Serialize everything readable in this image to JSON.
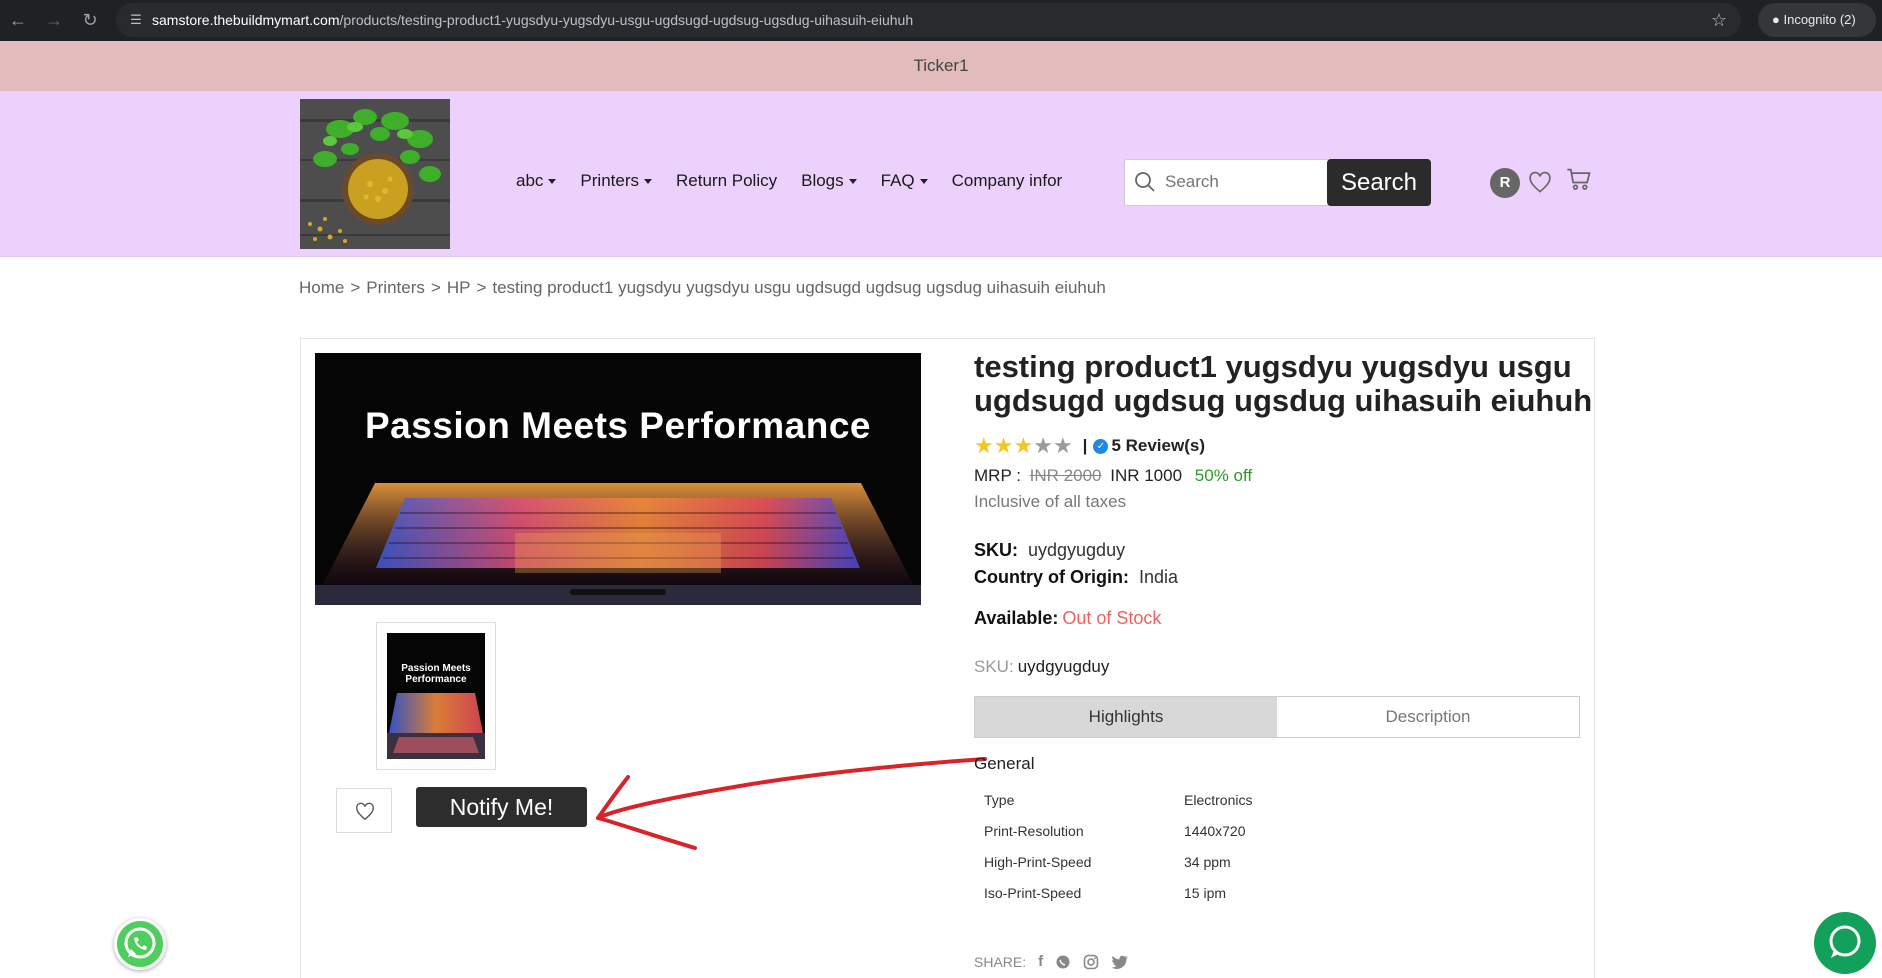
{
  "browser": {
    "url_host": "samstore.thebuildmymart.com",
    "url_path": "/products/testing-product1-yugsdyu-yugsdyu-usgu-ugdsugd-ugdsug-ugsdug-uihasuih-eiuhuh",
    "incognito_label": "Incognito (2)"
  },
  "ticker": {
    "text": "Ticker1"
  },
  "nav": {
    "items": [
      {
        "label": "abc",
        "dropdown": true
      },
      {
        "label": "Printers",
        "dropdown": true
      },
      {
        "label": "Return Policy",
        "dropdown": false
      },
      {
        "label": "Blogs",
        "dropdown": true
      },
      {
        "label": "FAQ",
        "dropdown": true
      },
      {
        "label": "Company infor",
        "dropdown": false
      }
    ]
  },
  "search": {
    "placeholder": "Search",
    "button_label": "Search"
  },
  "user": {
    "avatar_initial": "R"
  },
  "breadcrumb": [
    "Home",
    "Printers",
    "HP",
    "testing product1 yugsdyu yugsdyu usgu ugdsugd ugdsug ugsdug uihasuih eiuhuh"
  ],
  "product": {
    "image_title": "Passion Meets Performance",
    "title": "testing product1 yugsdyu yugsdyu usgu ugdsugd ugdsug ugsdug uihasuih eiuhuh",
    "rating": 3,
    "rating_max": 5,
    "rating_separator": "|",
    "reviews_label": "5 Review(s)",
    "mrp_label": "MRP :",
    "old_price": "INR 2000",
    "price": "INR 1000",
    "discount": "50% off",
    "tax_note": "Inclusive of all taxes",
    "sku_label": "SKU:",
    "sku": "uydgyugduy",
    "origin_label": "Country of Origin:",
    "origin": "India",
    "available_label": "Available:",
    "availability": "Out of Stock",
    "notify_label": "Notify Me!",
    "tabs": [
      "Highlights",
      "Description"
    ],
    "general_label": "General",
    "specs": [
      {
        "name": "Type",
        "value": "Electronics"
      },
      {
        "name": "Print-Resolution",
        "value": "1440x720"
      },
      {
        "name": "High-Print-Speed",
        "value": "34 ppm"
      },
      {
        "name": "Iso-Print-Speed",
        "value": "15 ipm"
      }
    ],
    "share_label": "SHARE:"
  },
  "colors": {
    "ticker_bg": "#e2bcbc",
    "header_bg": "#ecd1fc",
    "out_of_stock": "#f06060",
    "discount": "#2a9a2a",
    "annotation_arrow": "#d8232a"
  }
}
